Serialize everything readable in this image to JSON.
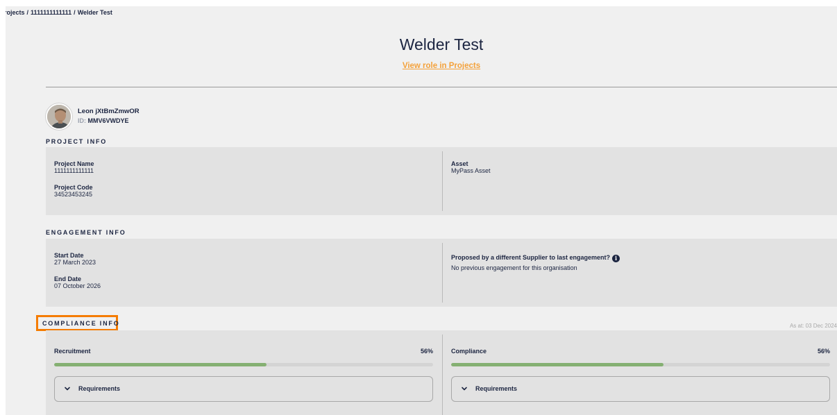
{
  "breadcrumb": [
    {
      "label": "Projects"
    },
    {
      "label": "1111111111111"
    },
    {
      "label": "Welder Test"
    }
  ],
  "breadcrumb_separator": "/",
  "page": {
    "title": "Welder Test",
    "view_role_link": "View role in Projects"
  },
  "profile": {
    "name": "Leon jXtBmZmwOR",
    "id_label": "ID:",
    "id_value": "MMV6VWDYE"
  },
  "project_info": {
    "title": "PROJECT INFO",
    "project_name_label": "Project Name",
    "project_name_value": "1111111111111",
    "project_code_label": "Project Code",
    "project_code_value": "34523453245",
    "asset_label": "Asset",
    "asset_value": "MyPass Asset"
  },
  "engagement_info": {
    "title": "ENGAGEMENT INFO",
    "start_date_label": "Start Date",
    "start_date_value": "27 March 2023",
    "end_date_label": "End Date",
    "end_date_value": "07 October 2026",
    "proposed_label": "Proposed by a different Supplier to last engagement?",
    "proposed_value": "No previous engagement for this organisation",
    "info_icon": "info-icon"
  },
  "compliance_info": {
    "title": "COMPLIANCE INFO",
    "as_at": "As at: 03 Dec 2024",
    "recruitment": {
      "label": "Recruitment",
      "percent_text": "56%",
      "progress": 0.56,
      "requirements_label": "Requirements"
    },
    "compliance": {
      "label": "Compliance",
      "percent_text": "56%",
      "progress": 0.56,
      "requirements_label": "Requirements"
    }
  },
  "colors": {
    "text": "#1c2541",
    "accent_link": "#f4a13a",
    "highlight": "#f57c00",
    "progress_fill": "#85b072",
    "panel_bg": "#e2e2e2",
    "page_bg": "#f0f0f0"
  }
}
